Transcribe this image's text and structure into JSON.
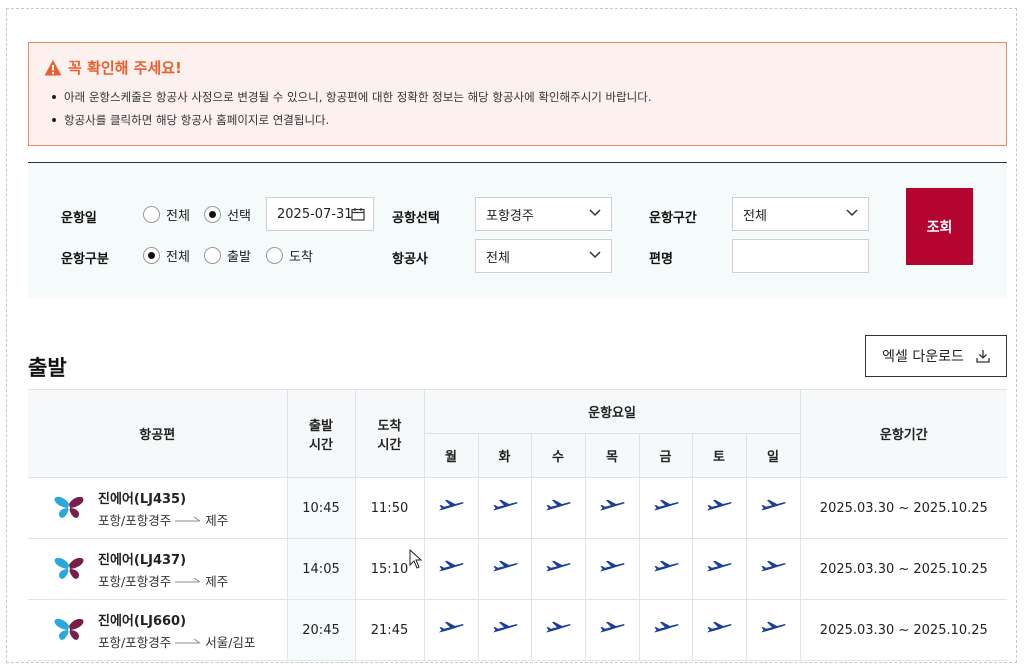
{
  "notice": {
    "title": "꼭 확인해 주세요!",
    "items": [
      "아래 운항스케줄은 항공사 사정으로 변경될 수 있으니, 항공편에 대한 정확한 정보는 해당 항공사에 확인해주시기 바랍니다.",
      "항공사를 클릭하면 해당 항공사 홈페이지로 연결됩니다."
    ]
  },
  "search": {
    "date_label": "운항일",
    "date_options": [
      "전체",
      "선택"
    ],
    "date_selected": "선택",
    "date_value": "2025-07-31",
    "type_label": "운항구분",
    "type_options": [
      "전체",
      "출발",
      "도착"
    ],
    "type_selected": "전체",
    "airport_label": "공항선택",
    "airport_value": "포항경주",
    "airline_label": "항공사",
    "airline_value": "전체",
    "route_label": "운항구간",
    "route_value": "전체",
    "flight_label": "편명",
    "flight_value": "",
    "submit_label": "조회"
  },
  "section": {
    "title": "출발",
    "excel_label": "엑셀 다운로드"
  },
  "table": {
    "headers": {
      "flight": "항공편",
      "dep_time": [
        "출발",
        "시간"
      ],
      "arr_time": [
        "도착",
        "시간"
      ],
      "days_group": "운항요일",
      "period": "운항기간"
    },
    "days": [
      "월",
      "화",
      "수",
      "목",
      "금",
      "토",
      "일"
    ],
    "rows": [
      {
        "airline": "진에어(LJ435)",
        "from": "포항/포항경주",
        "to": "제주",
        "dep": "10:45",
        "arr": "11:50",
        "days": [
          true,
          true,
          true,
          true,
          true,
          true,
          true
        ],
        "period": "2025.03.30 ~ 2025.10.25"
      },
      {
        "airline": "진에어(LJ437)",
        "from": "포항/포항경주",
        "to": "제주",
        "dep": "14:05",
        "arr": "15:10",
        "days": [
          true,
          true,
          true,
          true,
          true,
          true,
          true
        ],
        "period": "2025.03.30 ~ 2025.10.25"
      },
      {
        "airline": "진에어(LJ660)",
        "from": "포항/포항경주",
        "to": "서울/김포",
        "dep": "20:45",
        "arr": "21:45",
        "days": [
          true,
          true,
          true,
          true,
          true,
          true,
          true
        ],
        "period": "2025.03.30 ~ 2025.10.25"
      }
    ]
  },
  "colors": {
    "accent": "#b40531",
    "notice_title": "#e8602f",
    "plane": "#1a3f99"
  }
}
